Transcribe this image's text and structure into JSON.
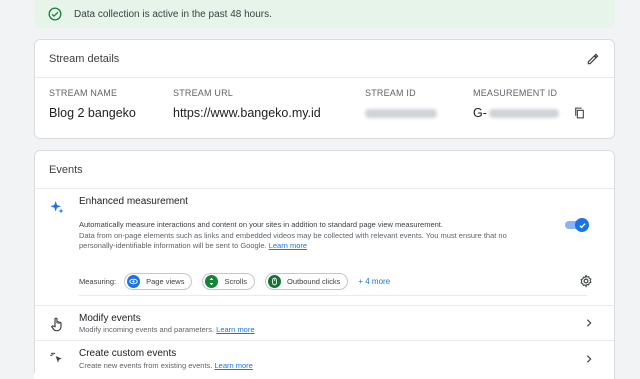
{
  "banner": {
    "text": "Data collection is active in the past 48 hours."
  },
  "stream_details": {
    "title": "Stream details",
    "columns": [
      {
        "label": "STREAM NAME",
        "value": "Blog 2 bangeko"
      },
      {
        "label": "STREAM URL",
        "value": "https://www.bangeko.my.id"
      },
      {
        "label": "STREAM ID",
        "value": ""
      },
      {
        "label": "MEASUREMENT ID",
        "value": "G-"
      }
    ]
  },
  "events": {
    "title": "Events",
    "enhanced": {
      "title": "Enhanced measurement",
      "desc_1": "Automatically measure interactions and content on your sites in addition to standard page view measurement.",
      "desc_2": "Data from on-page elements such as links and embedded videos may be collected with relevant events. You must ensure that no",
      "desc_3": "personally-identifiable information will be sent to Google.",
      "learn_more": "Learn more",
      "toggle_on": true,
      "measuring_label": "Measuring:",
      "chips": [
        "Page views",
        "Scrolls",
        "Outbound clicks"
      ],
      "more": "+ 4 more"
    },
    "modify": {
      "title": "Modify events",
      "desc": "Modify incoming events and parameters.",
      "learn_more": "Learn more"
    },
    "custom": {
      "title": "Create custom events",
      "desc": "Create new events from existing events.",
      "learn_more": "Learn more"
    }
  },
  "colors": {
    "accent": "#1a73e8",
    "banner_bg": "#e6f4ea",
    "success": "#188038"
  }
}
